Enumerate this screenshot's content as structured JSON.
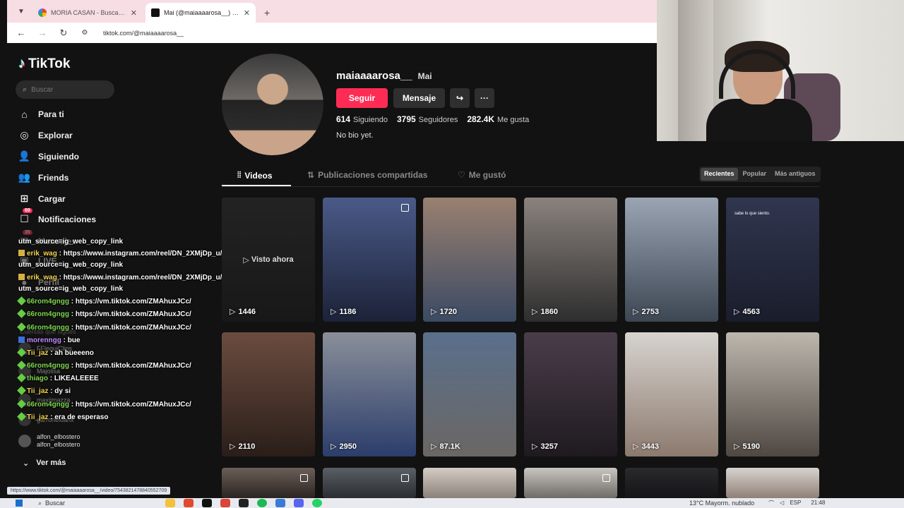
{
  "browser": {
    "tabs": [
      {
        "title": "MORIA CASAN - Buscar con Google",
        "active": false,
        "icon": "google-icon"
      },
      {
        "title": "Mai (@maiaaaarosa__) | TikTok",
        "active": true,
        "icon": "tiktok-icon"
      }
    ],
    "url": "tiktok.com/@maiaaaarosa__"
  },
  "sidebar": {
    "logo": "TikTok",
    "search_placeholder": "Buscar",
    "items": [
      {
        "label": "Para ti",
        "icon": "home-icon"
      },
      {
        "label": "Explorar",
        "icon": "compass-icon"
      },
      {
        "label": "Siguiendo",
        "icon": "following-icon"
      },
      {
        "label": "Friends",
        "icon": "friends-icon"
      },
      {
        "label": "Cargar",
        "icon": "upload-icon"
      },
      {
        "label": "Notificaciones",
        "icon": "bell-icon",
        "badge": "69"
      },
      {
        "label": "Mensajes",
        "icon": "message-icon",
        "badge": "35"
      },
      {
        "label": "LIVE",
        "icon": "live-icon"
      },
      {
        "label": "Perfil",
        "icon": "profile-icon"
      }
    ],
    "following_title": "Cuentas que sigues",
    "following": [
      {
        "name": "FFlequiClips",
        "handle": "flequiclips"
      },
      {
        "name": "Majolisa",
        "handle": ""
      },
      {
        "name": "maxiimazza",
        "handle": ""
      },
      {
        "name": "garroneluanx",
        "handle": ""
      },
      {
        "name": "alfon_elbostero",
        "handle": "alfon_elbostero"
      }
    ],
    "see_more": "Ver más"
  },
  "chat": [
    {
      "user": "",
      "text": "utm_source=ig_web_copy_link"
    },
    {
      "user": "erik_wag",
      "text": ": https://www.instagram.com/reel/DN_2XMjDp_u/?"
    },
    {
      "user": "",
      "text": "utm_source=ig_web_copy_link"
    },
    {
      "user": "erik_wag",
      "text": ": https://www.instagram.com/reel/DN_2XMjDp_u/?"
    },
    {
      "user": "",
      "text": "utm_source=ig_web_copy_link"
    },
    {
      "user": "66rom4gngg",
      "text": ": https://vm.tiktok.com/ZMAhuxJCc/"
    },
    {
      "user": "66rom4gngg",
      "text": ": https://vm.tiktok.com/ZMAhuxJCc/"
    },
    {
      "user": "66rom4gngg",
      "text": ": https://vm.tiktok.com/ZMAhuxJCc/"
    },
    {
      "user": "morenngg",
      "text": ": bue"
    },
    {
      "user": "Tii_jaz",
      "text": ": ah bueeeno"
    },
    {
      "user": "66rom4gngg",
      "text": ": https://vm.tiktok.com/ZMAhuxJCc/"
    },
    {
      "user": "thiago",
      "text": ": LIKEALEEEE"
    },
    {
      "user": "Tii_jaz",
      "text": ": dy si"
    },
    {
      "user": "66rom4gngg",
      "text": ": https://vm.tiktok.com/ZMAhuxJCc/"
    },
    {
      "user": "Tii_jaz",
      "text": ": era de esperaso"
    }
  ],
  "profile": {
    "handle": "maiaaaarosa__",
    "name": "Mai",
    "follow_label": "Seguir",
    "message_label": "Mensaje",
    "following_count": "614",
    "following_label": "Siguiendo",
    "followers_count": "3795",
    "followers_label": "Seguidores",
    "likes_count": "282.4K",
    "likes_label": "Me gusta",
    "bio": "No bio yet."
  },
  "tabs": [
    {
      "label": "Videos",
      "active": true,
      "icon": "grid-icon"
    },
    {
      "label": "Publicaciones compartidas",
      "active": false,
      "icon": "repost-icon"
    },
    {
      "label": "Me gustó",
      "active": false,
      "icon": "heart-icon"
    }
  ],
  "sort": [
    "Recientes",
    "Popular",
    "Más antiguos"
  ],
  "videos": [
    {
      "views": "1446",
      "watched": "Visto ahora",
      "colors": [
        "#3a3a3a",
        "#1f1f1f"
      ]
    },
    {
      "views": "1186",
      "multi": true,
      "colors": [
        "#4a5a88",
        "#1c2238"
      ]
    },
    {
      "views": "1720",
      "colors": [
        "#9a8070",
        "#3b4a63"
      ]
    },
    {
      "views": "1860",
      "colors": [
        "#8a827d",
        "#2e2e2e"
      ]
    },
    {
      "views": "2753",
      "multi": false,
      "colors": [
        "#9aa4b3",
        "#3d4653"
      ]
    },
    {
      "views": "4563",
      "caption": "sabe lo que siento.",
      "colors": [
        "#30364f",
        "#1a1d2b"
      ]
    },
    {
      "views": "2110",
      "colors": [
        "#6b4c3f",
        "#2a1e19"
      ]
    },
    {
      "views": "2950",
      "colors": [
        "#8a8f99",
        "#2b3d6b"
      ]
    },
    {
      "views": "87.1K",
      "colors": [
        "#5a6f8c",
        "#6b6764"
      ]
    },
    {
      "views": "3257",
      "colors": [
        "#4a3d4a",
        "#1f1a20"
      ]
    },
    {
      "views": "3443",
      "colors": [
        "#d7d3cf",
        "#8c7a6e"
      ]
    },
    {
      "views": "5190",
      "colors": [
        "#bdb7ae",
        "#4f4842"
      ]
    }
  ],
  "status_link": "https://www.tiktok.com/@maiaaaarosa__/video/7543821478840552709",
  "taskbar": {
    "search": "Buscar",
    "weather": "13°C  Mayorm. nublado",
    "lang": "ESP",
    "time": "21:48"
  }
}
